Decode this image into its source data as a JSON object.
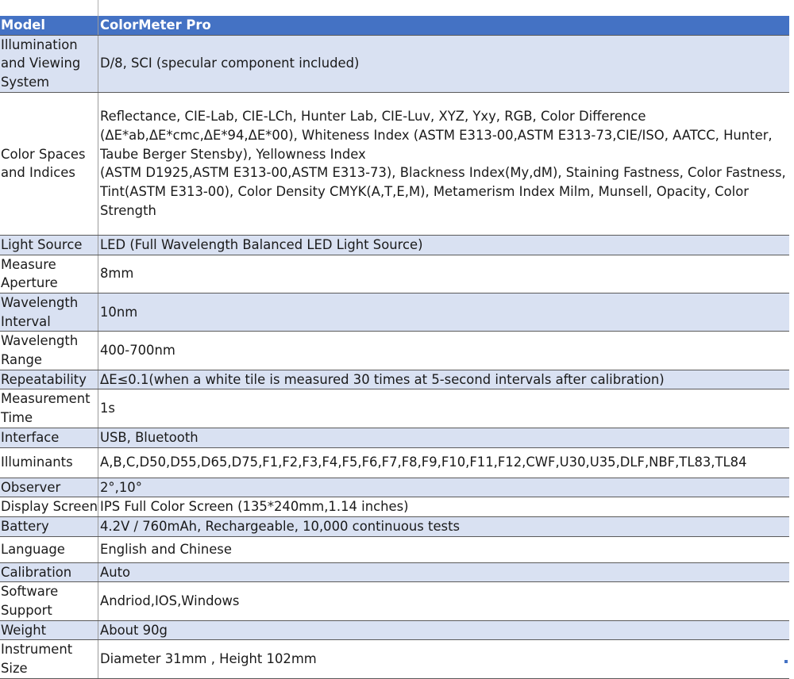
{
  "header": {
    "label": "Model",
    "value": "ColorMeter Pro"
  },
  "rows": [
    {
      "label": "Illumination and Viewing System",
      "value": "D/8, SCI (specular component included)"
    },
    {
      "label": "Color Spaces and Indices",
      "value": "Reflectance, CIE-Lab, CIE-LCh, Hunter Lab, CIE-Luv, XYZ, Yxy, RGB, Color Difference (ΔE*ab,ΔE*cmc,ΔE*94,ΔE*00), Whiteness Index (ASTM E313-00,ASTM E313-73,CIE/ISO, AATCC, Hunter, Taube Berger Stensby), Yellowness Index",
      "value2": "(ASTM D1925,ASTM E313-00,ASTM E313-73), Blackness Index(My,dM), Staining Fastness, Color Fastness, Tint(ASTM E313-00), Color Density CMYK(A,T,E,M), Metamerism Index Milm, Munsell, Opacity, Color Strength"
    },
    {
      "label": "Light Source",
      "value": "LED (Full Wavelength Balanced LED Light Source)"
    },
    {
      "label": "Measure Aperture",
      "value": "8mm"
    },
    {
      "label": "Wavelength Interval",
      "value": "10nm"
    },
    {
      "label": "Wavelength Range",
      "value": "400-700nm"
    },
    {
      "label": "Repeatability",
      "value": "ΔE≤0.1(when a white tile is measured 30 times at 5-second intervals after calibration)"
    },
    {
      "label": "Measurement Time",
      "value": "1s"
    },
    {
      "label": "Interface",
      "value": "USB, Bluetooth"
    },
    {
      "label": "Illuminants",
      "value": "A,B,C,D50,D55,D65,D75,F1,F2,F3,F4,F5,F6,F7,F8,F9,F10,F11,F12,CWF,U30,U35,DLF,NBF,TL83,TL84"
    },
    {
      "label": "Observer",
      "value": "2°,10°"
    },
    {
      "label": "Display Screen",
      "value": "IPS Full Color Screen (135*240mm,1.14 inches)"
    },
    {
      "label": "Battery",
      "value": "4.2V / 760mAh, Rechargeable, 10,000 continuous tests"
    },
    {
      "label": "Language",
      "value": "English and Chinese"
    },
    {
      "label": "Calibration",
      "value": "Auto"
    },
    {
      "label": "Software Support",
      "value": "Andriod,IOS,Windows"
    },
    {
      "label": "Weight",
      "value": "About 90g"
    },
    {
      "label": "Instrument Size",
      "value": "Diameter 31mm , Height 102mm"
    }
  ],
  "colors": {
    "header_bg": "#4472c4",
    "band_bg": "#d9e1f2",
    "plain_bg": "#ffffff"
  }
}
